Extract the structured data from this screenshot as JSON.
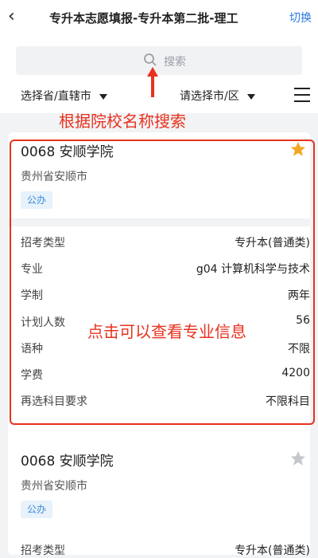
{
  "header": {
    "back_icon": "‹",
    "title": "专升本志愿填报-专升本第二批-理工",
    "switch_label": "切换"
  },
  "search": {
    "placeholder": "搜索"
  },
  "filters": {
    "province": "选择省/直辖市",
    "city": "请选择市/区"
  },
  "annotations": {
    "search_hint": "根据院校名称搜索",
    "detail_hint": "点击可以查看专业信息"
  },
  "cards": [
    {
      "name": "0068 安顺学院",
      "location": "贵州省安顺市",
      "badge": "公办",
      "favorited": true,
      "rows": [
        {
          "k": "招考类型",
          "v": "专升本(普通类)"
        },
        {
          "k": "专业",
          "v": "g04 计算机科学与技术"
        },
        {
          "k": "学制",
          "v": "两年"
        },
        {
          "k": "计划人数",
          "v": "56"
        },
        {
          "k": "语种",
          "v": "不限"
        },
        {
          "k": "学费",
          "v": "4200"
        },
        {
          "k": "再选科目要求",
          "v": "不限科目"
        }
      ]
    },
    {
      "name": "0068 安顺学院",
      "location": "贵州省安顺市",
      "badge": "公办",
      "favorited": false,
      "rows": [
        {
          "k": "招考类型",
          "v": "专升本(普通类)"
        }
      ]
    }
  ],
  "colors": {
    "accent": "#2a7ae4",
    "annotation": "#e8321f",
    "star_on": "#f5a623",
    "star_off": "#c4c7cc"
  }
}
